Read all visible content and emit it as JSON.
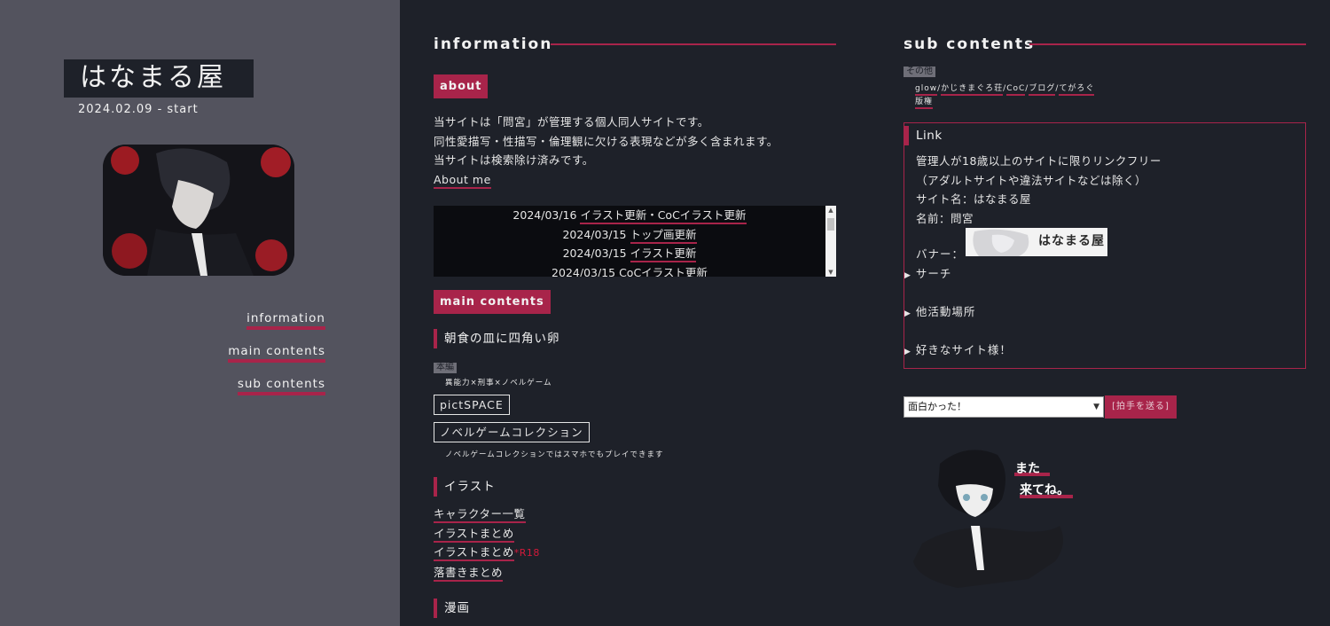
{
  "sidebar": {
    "site_title": "はなまる屋",
    "start_date": "2024.02.09 - start",
    "nav": [
      {
        "label": "information"
      },
      {
        "label": "main contents"
      },
      {
        "label": "sub contents"
      }
    ]
  },
  "information": {
    "heading": "information",
    "about_tag": "about",
    "about_lines": [
      "当サイトは「問宮」が管理する個人同人サイトです。",
      "同性愛描写・性描写・倫理観に欠ける表現などが多く含まれます。",
      "当サイトは検索除け済みです。"
    ],
    "about_me_link": "About me",
    "news": [
      {
        "date": "2024/03/16",
        "text": "イラスト更新・CoCイラスト更新"
      },
      {
        "date": "2024/03/15",
        "text": "トップ画更新"
      },
      {
        "date": "2024/03/15",
        "text": "イラスト更新"
      },
      {
        "date": "2024/03/15",
        "text": "CoCイラスト更新"
      }
    ]
  },
  "main_contents": {
    "tag": "main contents",
    "novel": {
      "heading": "朝食の皿に四角い卵",
      "honpen_tag": "本編",
      "genre": "異能力×刑事×ノベルゲーム",
      "button_pictspace": "pictSPACE",
      "button_novelgame": "ノベルゲームコレクション",
      "note": "ノベルゲームコレクションではスマホでもプレイできます"
    },
    "illust": {
      "heading": "イラスト",
      "links": [
        {
          "label": "キャラクター一覧",
          "badge": ""
        },
        {
          "label": "イラストまとめ",
          "badge": ""
        },
        {
          "label": "イラストまとめ",
          "badge": "*R18"
        },
        {
          "label": "落書きまとめ",
          "badge": ""
        }
      ]
    },
    "manga_heading": "漫画"
  },
  "sub_contents": {
    "heading": "sub contents",
    "other_tag": "その他",
    "other_links": [
      "glow",
      "かじきまぐろ荘",
      "CoC",
      "ブログ",
      "てがろぐ"
    ],
    "other_link_2": "版権",
    "link_box": {
      "heading": "Link",
      "lines": [
        "管理人が18歳以上のサイトに限りリンクフリー",
        "（アダルトサイトや違法サイトなどは除く）",
        "サイト名：はなまる屋",
        "名前：問宮"
      ],
      "banner_label": "バナー：",
      "banner_text": "はなまる屋",
      "details": [
        "サーチ",
        "他活動場所",
        "好きなサイト様！"
      ]
    },
    "clap": {
      "select_value": "面白かった！",
      "send_label": "[拍手を送る]"
    },
    "chibi_text": [
      "また",
      "来てね。"
    ]
  },
  "colors": {
    "accent": "#a8244a",
    "sidebar_bg": "#53535e",
    "main_bg": "#1e2129"
  }
}
